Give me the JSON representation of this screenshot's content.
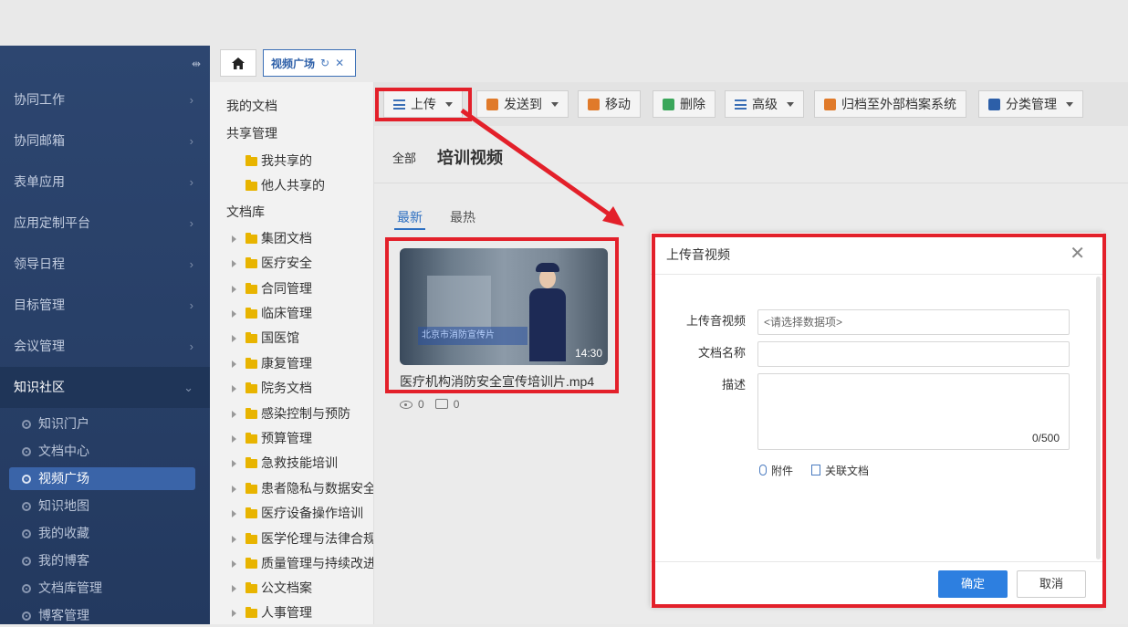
{
  "sidebar": {
    "menu": [
      {
        "label": "协同工作"
      },
      {
        "label": "协同邮箱"
      },
      {
        "label": "表单应用"
      },
      {
        "label": "应用定制平台"
      },
      {
        "label": "领导日程"
      },
      {
        "label": "目标管理"
      },
      {
        "label": "会议管理"
      },
      {
        "label": "知识社区"
      }
    ],
    "sub": [
      {
        "label": "知识门户"
      },
      {
        "label": "文档中心"
      },
      {
        "label": "视频广场"
      },
      {
        "label": "知识地图"
      },
      {
        "label": "我的收藏"
      },
      {
        "label": "我的博客"
      },
      {
        "label": "文档库管理"
      },
      {
        "label": "博客管理"
      }
    ]
  },
  "tabs": {
    "active_label": "视频广场"
  },
  "tree": {
    "items": [
      "我的文档",
      "共享管理",
      "我共享的",
      "他人共享的",
      "文档库",
      "集团文档",
      "医疗安全",
      "合同管理",
      "临床管理",
      "国医馆",
      "康复管理",
      "院务文档",
      "感染控制与预防",
      "预算管理",
      "急救技能培训",
      "患者隐私与数据安全",
      "医疗设备操作培训",
      "医学伦理与法律合规",
      "质量管理与持续改进",
      "公文档案",
      "人事管理"
    ]
  },
  "toolbar": {
    "upload": "上传",
    "send_to": "发送到",
    "move": "移动",
    "delete": "删除",
    "advanced": "高级",
    "archive": "归档至外部档案系统",
    "category": "分类管理"
  },
  "main": {
    "crumb_all": "全部",
    "title": "培训视频",
    "tab_new": "最新",
    "tab_hot": "最热",
    "video": {
      "title": "医疗机构消防安全宣传培训片.mp4",
      "duration": "14:30",
      "views": "0",
      "comments": "0",
      "banner": "北京市消防宣传片"
    }
  },
  "dialog": {
    "title": "上传音视频",
    "label_file": "上传音视频",
    "placeholder_file": "<请选择数据项>",
    "label_name": "文档名称",
    "label_desc": "描述",
    "counter": "0/500",
    "attach": "附件",
    "link_doc": "关联文档",
    "ok": "确定",
    "cancel": "取消"
  },
  "colors": {
    "annotation_red": "#e3202a",
    "primary_blue": "#2d7fe0",
    "sidebar_bg": "#2d4670"
  }
}
